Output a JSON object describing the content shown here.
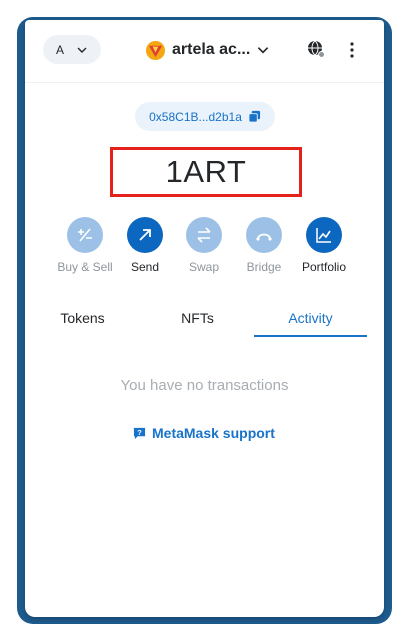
{
  "header": {
    "account_label": "A",
    "network_name": "artela ac...",
    "icons": [
      "chevron-down-icon",
      "network-logo-icon",
      "globe-icon",
      "kebab-menu-icon"
    ]
  },
  "address": {
    "short": "0x58C1B...d2b1a",
    "icon": "copy-icon"
  },
  "balance": {
    "text": "1ART",
    "highlight_color": "#e5211b"
  },
  "actions": [
    {
      "label": "Buy & Sell",
      "enabled": false,
      "icon": "plus-minus-icon"
    },
    {
      "label": "Send",
      "enabled": true,
      "icon": "arrow-up-right-icon"
    },
    {
      "label": "Swap",
      "enabled": false,
      "icon": "swap-arrows-icon"
    },
    {
      "label": "Bridge",
      "enabled": false,
      "icon": "bridge-icon"
    },
    {
      "label": "Portfolio",
      "enabled": true,
      "icon": "chart-line-icon"
    }
  ],
  "tabs": [
    {
      "label": "Tokens",
      "active": false
    },
    {
      "label": "NFTs",
      "active": false
    },
    {
      "label": "Activity",
      "active": true
    }
  ],
  "activity": {
    "empty_text": "You have no transactions",
    "support_link": "MetaMask support",
    "support_icon": "chat-question-icon"
  },
  "colors": {
    "accent": "#1873c9",
    "frame": "#1e5c8f",
    "disabled_action": "#9dc1e6"
  }
}
